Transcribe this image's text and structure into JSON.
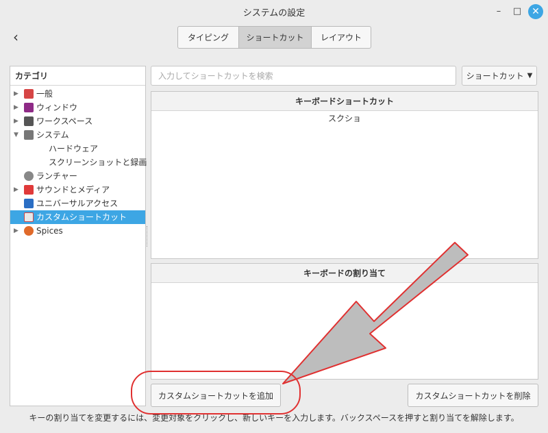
{
  "window": {
    "title": "システムの設定",
    "minimize_label": "–",
    "maximize_label": "□",
    "close_label": "✕"
  },
  "nav": {
    "back_label": "‹"
  },
  "tabs": [
    {
      "label": "タイピング",
      "active": false
    },
    {
      "label": "ショートカット",
      "active": true
    },
    {
      "label": "レイアウト",
      "active": false
    }
  ],
  "sidebar": {
    "header": "カテゴリ",
    "items": [
      {
        "label": "一般",
        "expander": "▶",
        "icon": "general-icon",
        "color": "#d64545"
      },
      {
        "label": "ウィンドウ",
        "expander": "▶",
        "icon": "windows-icon",
        "color": "#8e2a86"
      },
      {
        "label": "ワークスペース",
        "expander": "▶",
        "icon": "workspace-icon",
        "color": "#555555"
      },
      {
        "label": "システム",
        "expander": "▼",
        "icon": "system-icon",
        "color": "#777777"
      },
      {
        "label": "ハードウェア",
        "sub": true
      },
      {
        "label": "スクリーンショットと録画",
        "sub": true
      },
      {
        "label": "ランチャー",
        "expander": "",
        "icon": "launcher-icon",
        "color": "#888888"
      },
      {
        "label": "サウンドとメディア",
        "expander": "▶",
        "icon": "sound-media-icon",
        "color": "#e03a3a"
      },
      {
        "label": "ユニバーサルアクセス",
        "expander": "",
        "icon": "accessibility-icon",
        "color": "#2a6ec4"
      },
      {
        "label": "カスタムショートカット",
        "expander": "",
        "icon": "custom-shortcut-icon",
        "color": "#e8e8e8",
        "selected": true
      },
      {
        "label": "Spices",
        "expander": "▶",
        "icon": "spices-icon",
        "color": "#e06a2a"
      }
    ]
  },
  "search": {
    "placeholder": "入力してショートカットを検索"
  },
  "dropdown": {
    "label": "ショートカット",
    "arrow": "▼"
  },
  "shortcuts_panel": {
    "header": "キーボードショートカット",
    "rows": [
      "スクショ"
    ]
  },
  "bindings_panel": {
    "header": "キーボードの割り当て"
  },
  "buttons": {
    "add": "カスタムショートカットを追加",
    "remove": "カスタムショートカットを削除"
  },
  "hint": "キーの割り当てを変更するには、変更対象をクリックし、新しいキーを入力します。バックスペースを押すと割り当てを解除します。",
  "annotation": {
    "color": "#e03030",
    "arrow_fill": "#bdbdbd"
  }
}
